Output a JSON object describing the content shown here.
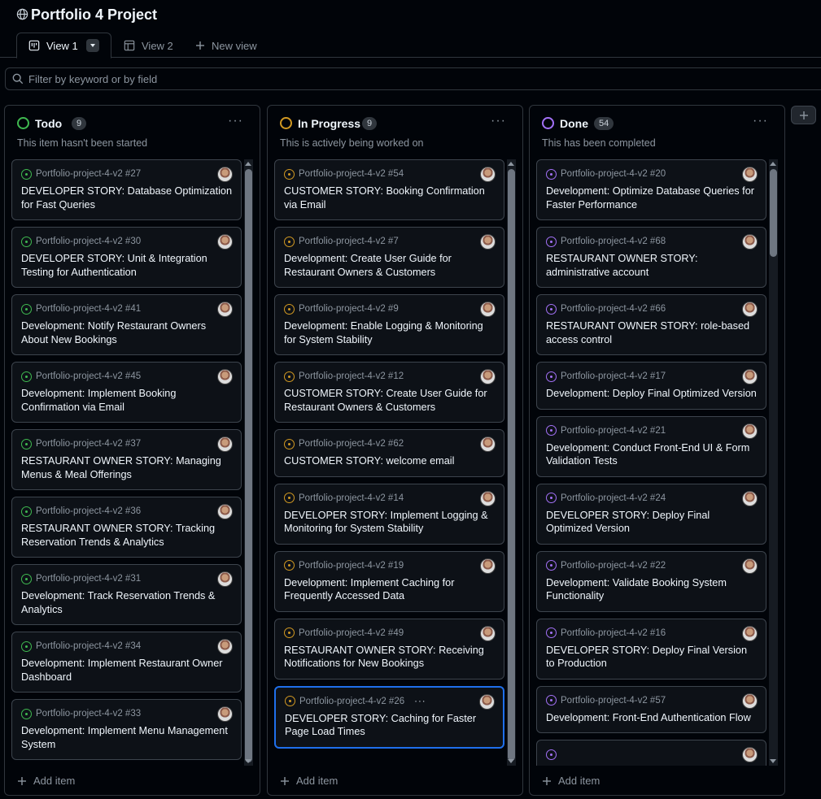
{
  "project": {
    "title": "Portfolio 4 Project"
  },
  "tabs": [
    {
      "label": "View 1"
    },
    {
      "label": "View 2"
    },
    {
      "label": "New view"
    }
  ],
  "filter": {
    "placeholder": "Filter by keyword or by field"
  },
  "colors": {
    "todo": "#3fb950",
    "in_progress": "#d29922",
    "done": "#a371f7",
    "selected_border": "#1f6feb"
  },
  "columns": [
    {
      "name": "Todo",
      "count": "9",
      "description": "This item hasn't been started",
      "status_color": "#3fb950",
      "add_label": "Add item",
      "cards": [
        {
          "ref": "Portfolio-project-4-v2 #27",
          "title": "DEVELOPER STORY: Database Optimization for Fast Queries"
        },
        {
          "ref": "Portfolio-project-4-v2 #30",
          "title": "DEVELOPER STORY: Unit & Integration Testing for Authentication"
        },
        {
          "ref": "Portfolio-project-4-v2 #41",
          "title": "Development: Notify Restaurant Owners About New Bookings"
        },
        {
          "ref": "Portfolio-project-4-v2 #45",
          "title": "Development: Implement Booking Confirmation via Email"
        },
        {
          "ref": "Portfolio-project-4-v2 #37",
          "title": "RESTAURANT OWNER STORY: Managing Menus & Meal Offerings"
        },
        {
          "ref": "Portfolio-project-4-v2 #36",
          "title": "RESTAURANT OWNER STORY: Tracking Reservation Trends & Analytics"
        },
        {
          "ref": "Portfolio-project-4-v2 #31",
          "title": "Development: Track Reservation Trends & Analytics"
        },
        {
          "ref": "Portfolio-project-4-v2 #34",
          "title": "Development: Implement Restaurant Owner Dashboard"
        },
        {
          "ref": "Portfolio-project-4-v2 #33",
          "title": "Development: Implement Menu Management System"
        }
      ]
    },
    {
      "name": "In Progress",
      "count": "9",
      "description": "This is actively being worked on",
      "status_color": "#d29922",
      "add_label": "Add item",
      "cards": [
        {
          "ref": "Portfolio-project-4-v2 #54",
          "title": "CUSTOMER STORY: Booking Confirmation via Email"
        },
        {
          "ref": "Portfolio-project-4-v2 #7",
          "title": "Development: Create User Guide for Restaurant Owners & Customers"
        },
        {
          "ref": "Portfolio-project-4-v2 #9",
          "title": "Development: Enable Logging & Monitoring for System Stability"
        },
        {
          "ref": "Portfolio-project-4-v2 #12",
          "title": "CUSTOMER STORY: Create User Guide for Restaurant Owners & Customers"
        },
        {
          "ref": "Portfolio-project-4-v2 #62",
          "title": "CUSTOMER STORY: welcome email"
        },
        {
          "ref": "Portfolio-project-4-v2 #14",
          "title": "DEVELOPER STORY: Implement Logging & Monitoring for System Stability"
        },
        {
          "ref": "Portfolio-project-4-v2 #19",
          "title": "Development: Implement Caching for Frequently Accessed Data"
        },
        {
          "ref": "Portfolio-project-4-v2 #49",
          "title": "RESTAURANT OWNER STORY: Receiving Notifications for New Bookings"
        },
        {
          "ref": "Portfolio-project-4-v2 #26",
          "title": "DEVELOPER STORY: Caching for Faster Page Load Times",
          "selected": true,
          "more": "···"
        }
      ]
    },
    {
      "name": "Done",
      "count": "54",
      "description": "This has been completed",
      "status_color": "#a371f7",
      "add_label": "Add item",
      "cards": [
        {
          "ref": "Portfolio-project-4-v2 #20",
          "title": "Development: Optimize Database Queries for Faster Performance"
        },
        {
          "ref": "Portfolio-project-4-v2 #68",
          "title": "RESTAURANT OWNER STORY: administrative account"
        },
        {
          "ref": "Portfolio-project-4-v2 #66",
          "title": "RESTAURANT OWNER STORY: role-based access control"
        },
        {
          "ref": "Portfolio-project-4-v2 #17",
          "title": "Development: Deploy Final Optimized Version"
        },
        {
          "ref": "Portfolio-project-4-v2 #21",
          "title": "Development: Conduct Front-End UI & Form Validation Tests"
        },
        {
          "ref": "Portfolio-project-4-v2 #24",
          "title": "DEVELOPER STORY: Deploy Final Optimized Version"
        },
        {
          "ref": "Portfolio-project-4-v2 #22",
          "title": "Development: Validate Booking System Functionality"
        },
        {
          "ref": "Portfolio-project-4-v2 #16",
          "title": "DEVELOPER STORY: Deploy Final Version to Production"
        },
        {
          "ref": "Portfolio-project-4-v2 #57",
          "title": "Development: Front-End Authentication Flow"
        },
        {
          "ref": "",
          "title": ""
        }
      ]
    }
  ]
}
